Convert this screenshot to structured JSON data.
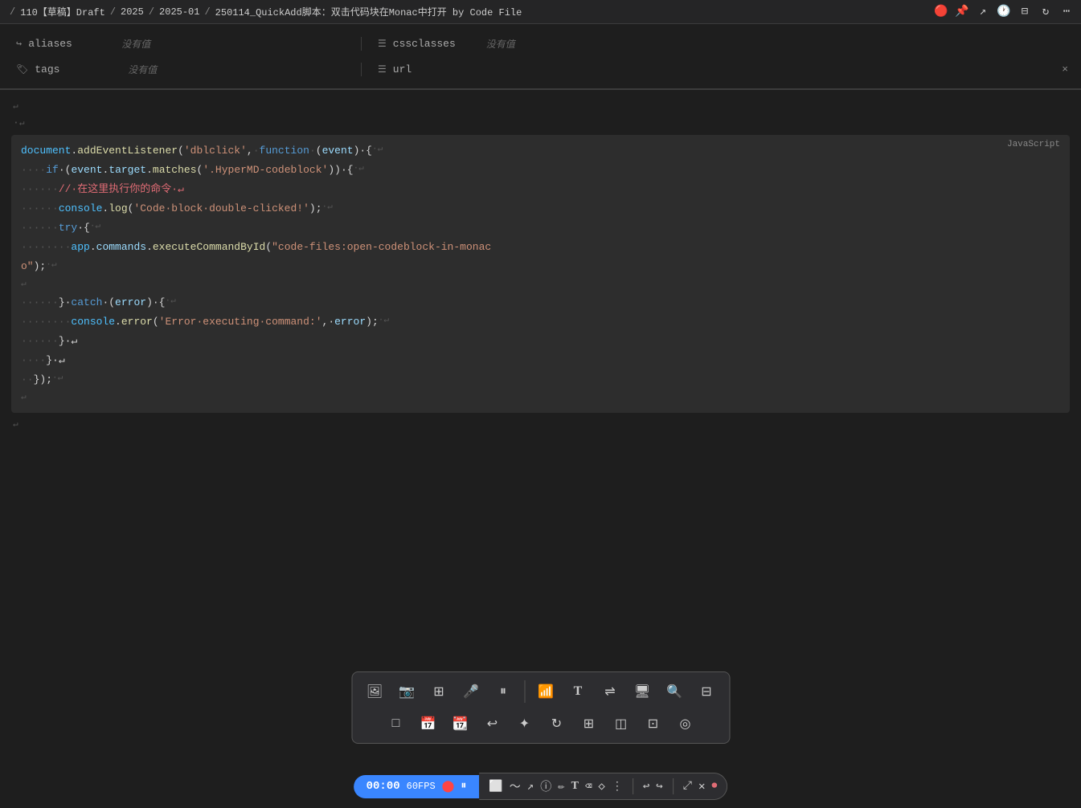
{
  "topbar": {
    "breadcrumb": "/ 110【草稿】Draft / 2025 / 2025-01 / 250114_QuickAdd脚本：双击代码块在Monac中打开 by Code File",
    "sep1": "/",
    "part1": "110【草稿】Draft",
    "sep2": "/",
    "part2": "2025",
    "sep3": "/",
    "part3": "2025-01",
    "sep4": "/",
    "part4": "250114_QuickAdd脚本：双击代码块在Monac中打开 by Code File"
  },
  "meta": {
    "row1_left_icon": "↪",
    "row1_left_label": "aliases",
    "row1_left_value": "没有值",
    "row1_right_icon": "☰",
    "row1_right_label": "cssclasses",
    "row1_right_value": "没有值",
    "row2_left_icon": "🏷",
    "row2_left_label": "tags",
    "row2_left_value": "没有值",
    "row2_right_icon": "☰",
    "row2_right_label": "url",
    "row2_right_close": "×"
  },
  "code": {
    "lang": "JavaScript",
    "lines": [
      {
        "dots": "",
        "content": "↵"
      },
      {
        "dots": "·",
        "content": "↵"
      },
      {
        "dots": "",
        "code_html": true,
        "raw": "document.addEventListener('dblclick',·function·(event)·{·↵"
      },
      {
        "dots": "····",
        "code_html": true,
        "raw": "if·(event.target.matches('.HyperMD-codeblock'))·{·↵"
      },
      {
        "dots": "······",
        "code_html": true,
        "raw": "//·在这里执行你的命令·↵",
        "is_comment": true
      },
      {
        "dots": "······",
        "code_html": true,
        "raw": "console.log('Code·block·double-clicked!');·↵"
      },
      {
        "dots": "······",
        "code_html": true,
        "raw": "try·{·↵"
      },
      {
        "dots": "········",
        "code_html": true,
        "raw": "app.commands.executeCommandById(\"code-files:open-codeblock-in-monac↵o\");·↵"
      },
      {
        "dots": "",
        "content": "↵"
      },
      {
        "dots": "······",
        "code_html": true,
        "raw": "}·catch·(error)·{·↵"
      },
      {
        "dots": "········",
        "code_html": true,
        "raw": "console.error('Error·executing·command:',·error);·↵"
      },
      {
        "dots": "······",
        "code_html": true,
        "raw": "}·↵"
      },
      {
        "dots": "····",
        "code_html": true,
        "raw": "}·↵"
      },
      {
        "dots": "··",
        "code_html": true,
        "raw": "});·↵"
      },
      {
        "dots": "",
        "content": "↵"
      },
      {
        "dots": "",
        "content": "↵"
      }
    ]
  },
  "toolbar": {
    "row1_buttons": [
      {
        "name": "image-icon",
        "symbol": "🖼",
        "label": "image"
      },
      {
        "name": "photo-icon",
        "symbol": "📷",
        "label": "photo"
      },
      {
        "name": "grid-icon",
        "symbol": "⊞",
        "label": "grid"
      },
      {
        "name": "mic-icon",
        "symbol": "🎤",
        "label": "mic"
      },
      {
        "name": "pause-icon",
        "symbol": "⏸",
        "label": "pause"
      },
      {
        "name": "sep1",
        "is_sep": true
      },
      {
        "name": "wifi-icon",
        "symbol": "📶",
        "label": "wifi"
      },
      {
        "name": "text-icon",
        "symbol": "T",
        "label": "text"
      },
      {
        "name": "swap-icon",
        "symbol": "⇌",
        "label": "swap"
      },
      {
        "name": "monitor-icon",
        "symbol": "🖥",
        "label": "monitor"
      },
      {
        "name": "search-icon",
        "symbol": "🔍",
        "label": "search"
      },
      {
        "name": "table-icon",
        "symbol": "⊟",
        "label": "table"
      }
    ],
    "row2_buttons": [
      {
        "name": "square-icon",
        "symbol": "□",
        "label": "square"
      },
      {
        "name": "calendar-icon",
        "symbol": "📅",
        "label": "calendar"
      },
      {
        "name": "calendar2-icon",
        "symbol": "📆",
        "label": "calendar2"
      },
      {
        "name": "arrow-icon",
        "symbol": "↩",
        "label": "arrow"
      },
      {
        "name": "move-icon",
        "symbol": "✦",
        "label": "move"
      },
      {
        "name": "rotate-icon",
        "symbol": "↻",
        "label": "rotate"
      },
      {
        "name": "columns-icon",
        "symbol": "⊞",
        "label": "columns"
      },
      {
        "name": "layers-icon",
        "symbol": "◫",
        "label": "layers"
      },
      {
        "name": "select-icon",
        "symbol": "⊡",
        "label": "select"
      },
      {
        "name": "target-icon",
        "symbol": "◎",
        "label": "target"
      }
    ]
  },
  "recording_bar": {
    "time": "00:00",
    "fps": "60FPS",
    "controls": [
      {
        "name": "rec-dot",
        "symbol": "●"
      },
      {
        "name": "pause-btn",
        "symbol": "⏸"
      }
    ],
    "right_controls": [
      {
        "name": "cursor-icon",
        "symbol": "⬜"
      },
      {
        "name": "path-icon",
        "symbol": "〜"
      },
      {
        "name": "arrow-icon",
        "symbol": "↗"
      },
      {
        "name": "info-icon",
        "symbol": "ⓘ"
      },
      {
        "name": "pen-icon",
        "symbol": "✏"
      },
      {
        "name": "text-icon",
        "symbol": "T"
      },
      {
        "name": "eraser-icon",
        "symbol": "⌫"
      },
      {
        "name": "shape-icon",
        "symbol": "◇"
      },
      {
        "name": "more-icon",
        "symbol": "⋮"
      },
      {
        "name": "sep",
        "is_sep": true
      },
      {
        "name": "undo-icon",
        "symbol": "↩"
      },
      {
        "name": "redo-icon",
        "symbol": "↪"
      },
      {
        "name": "sep2",
        "is_sep": true
      },
      {
        "name": "fullscreen-icon",
        "symbol": "⤢"
      },
      {
        "name": "close-icon",
        "symbol": "✕"
      },
      {
        "name": "record-icon",
        "symbol": "⏺",
        "is_red": true
      }
    ]
  }
}
